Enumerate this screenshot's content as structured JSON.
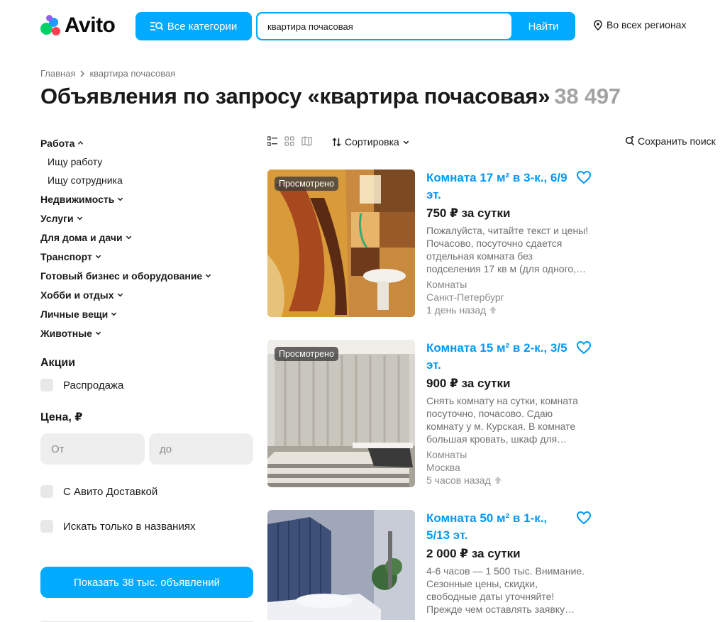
{
  "header": {
    "logo_text": "Avito",
    "categories_label": "Все категории",
    "search_value": "квартира почасовая",
    "search_button": "Найти",
    "region": "Во всех регионах"
  },
  "breadcrumbs": [
    "Главная",
    "квартира почасовая"
  ],
  "page_title": "Объявления по запросу «квартира почасовая»",
  "result_count": "38 497",
  "sidebar": {
    "categories": [
      {
        "label": "Работа",
        "expanded": true,
        "children": [
          "Ищу работу",
          "Ищу сотрудника"
        ]
      },
      {
        "label": "Недвижимость"
      },
      {
        "label": "Услуги"
      },
      {
        "label": "Для дома и дачи"
      },
      {
        "label": "Транспорт"
      },
      {
        "label": "Готовый бизнес и оборудование"
      },
      {
        "label": "Хобби и отдых"
      },
      {
        "label": "Личные вещи"
      },
      {
        "label": "Животные"
      }
    ],
    "promo_heading": "Акции",
    "sale_label": "Распродажа",
    "price_heading": "Цена, ₽",
    "price_from_placeholder": "От",
    "price_to_placeholder": "до",
    "delivery_label": "С Авито Доставкой",
    "titles_only_label": "Искать только в названиях",
    "show_button": "Показать 38 тыс. объявлений"
  },
  "toolbar": {
    "sort_label": "Сортировка",
    "save_search": "Сохранить поиск"
  },
  "listings": [
    {
      "badge": "Просмотрено",
      "title": "Комната 17 м² в 3-к., 6/9 эт.",
      "price": "750 ₽ за сутки",
      "description": "Пожалуйста, читайте текст и цены! Почасово, посуточно сдается отдельная комната без подселения 17 кв м (для одного,…",
      "category": "Комнаты",
      "city": "Санкт-Петербург",
      "time": "1 день назад"
    },
    {
      "badge": "Просмотрено",
      "title": "Комната 15 м² в 2-к., 3/5 эт.",
      "price": "900 ₽ за сутки",
      "description": "Снять комнату на сутки, комната посуточно, почасово. Сдаю комнату у м. Курская. В комнате большая кровать, шкаф для…",
      "category": "Комнаты",
      "city": "Москва",
      "time": "5 часов назад"
    },
    {
      "title": "Комната 50 м² в 1-к., 5/13 эт.",
      "price": "2 000 ₽ за сутки",
      "description": "4-6 часов — 1 500 тыс. Внимание. Сезонные цены, скидки, свободные даты уточняйте! Прежде чем оставлять заявку…"
    }
  ],
  "colors": {
    "accent": "#00aaff",
    "link": "#0099f7",
    "logo_green": "#00d26a",
    "logo_blue": "#1e9bff",
    "logo_red": "#ff4053",
    "logo_purple": "#965eeb"
  }
}
